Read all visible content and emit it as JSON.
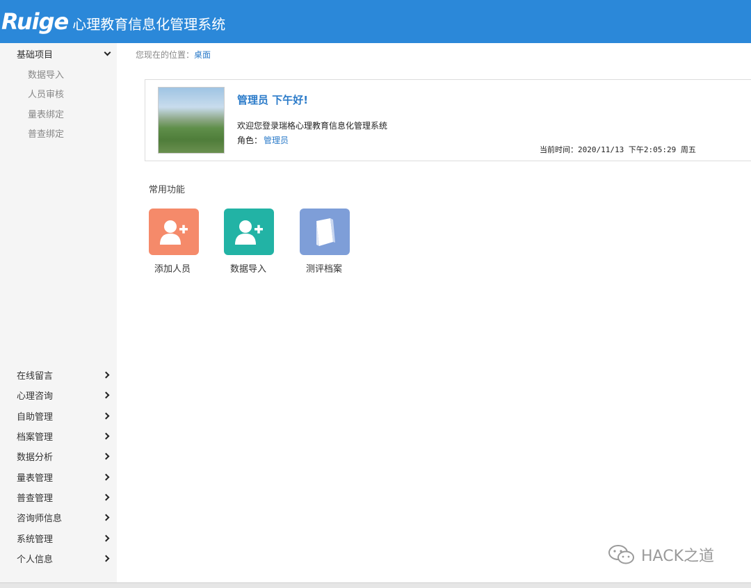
{
  "header": {
    "logo": "Ruige",
    "title": "心理教育信息化管理系统"
  },
  "sidebar": {
    "group": {
      "label": "基础项目",
      "icon": "chevron-down-icon"
    },
    "sub_items": [
      "数据导入",
      "人员审核",
      "量表绑定",
      "普查绑定"
    ],
    "items": [
      "在线留言",
      "心理咨询",
      "自助管理",
      "档案管理",
      "数据分析",
      "量表管理",
      "普查管理",
      "咨询师信息",
      "系统管理",
      "个人信息"
    ]
  },
  "breadcrumb": {
    "prefix": "您现在的位置：",
    "current": "桌面"
  },
  "welcome": {
    "greeting": "管理员 下午好!",
    "message": "欢迎您登录瑞格心理教育信息化管理系统",
    "role_label": "角色：",
    "role_value": "管理员",
    "time": "当前时间：2020/11/13 下午2:05:29 周五"
  },
  "shortcuts": {
    "title": "常用功能",
    "items": [
      {
        "label": "添加人员",
        "icon": "add-user-icon",
        "color": "#f58a6a"
      },
      {
        "label": "数据导入",
        "icon": "add-user-icon",
        "color": "#22b3a5"
      },
      {
        "label": "测评档案",
        "icon": "book-icon",
        "color": "#7e9ed8"
      }
    ]
  },
  "colors": {
    "header": "#2b88d9",
    "accent": "#2b7bc9"
  },
  "watermark": {
    "text": "HACK之道",
    "icon": "wechat-icon"
  }
}
